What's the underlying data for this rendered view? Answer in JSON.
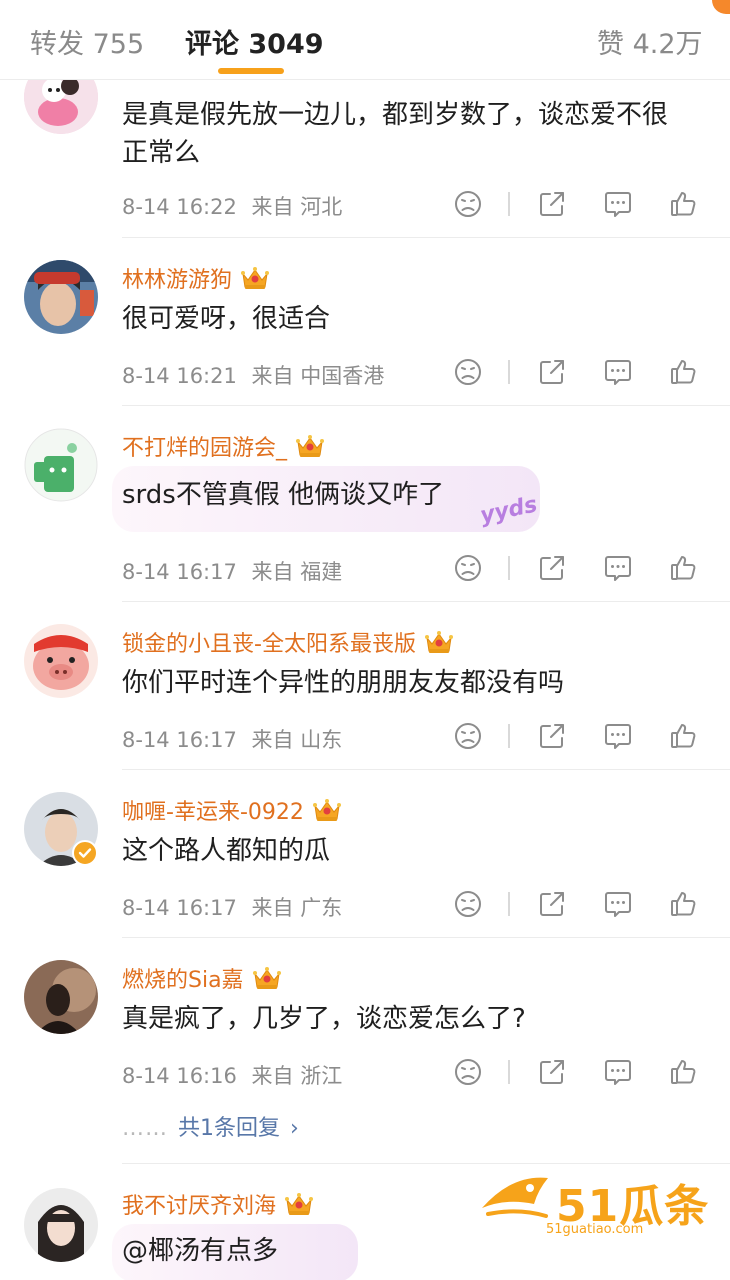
{
  "tabs": {
    "repost": "转发 755",
    "comments": "评论 3049",
    "likes": "赞 4.2万"
  },
  "comments": [
    {
      "username": "",
      "text": "是真是假先放一边儿，都到岁数了，谈恋爱不很正常么",
      "time": "8-14 16:22",
      "location": "来自 河北"
    },
    {
      "username": "林林游游狗",
      "text": "很可爱呀，很适合",
      "time": "8-14 16:21",
      "location": "来自 中国香港"
    },
    {
      "username": "不打烊的园游会_",
      "text": "srds不管真假 他俩谈又咋了",
      "bubble_tag": "yyds",
      "time": "8-14 16:17",
      "location": "来自 福建"
    },
    {
      "username": "锁金的小且丧-全太阳系最丧版",
      "text": "你们平时连个异性的朋朋友友都没有吗",
      "time": "8-14 16:17",
      "location": "来自 山东"
    },
    {
      "username": "咖喱-幸运来-0922",
      "text": "这个路人都知的瓜",
      "time": "8-14 16:17",
      "location": "来自 广东"
    },
    {
      "username": "燃烧的Sia嘉",
      "text": "真是疯了，几岁了，谈恋爱怎么了?",
      "time": "8-14 16:16",
      "location": "来自 浙江",
      "replies": "共1条回复",
      "replies_dots": "……",
      "replies_chevron": "›"
    },
    {
      "username": "我不讨厌齐刘海",
      "text": "@椰汤有点多"
    }
  ],
  "icons": {
    "dislike": "dislike-face-icon",
    "repost": "share-icon",
    "comment": "comment-icon",
    "like": "thumbs-up-icon",
    "crown": "crown-badge-icon",
    "verified": "verified-icon"
  },
  "colors": {
    "username": "#e0701f",
    "accent": "#f7a11b",
    "reply_link": "#5877a8",
    "watermark": "#f6a31a"
  },
  "watermark": {
    "logo": "51瓜条",
    "url": "51guatiao.com"
  }
}
